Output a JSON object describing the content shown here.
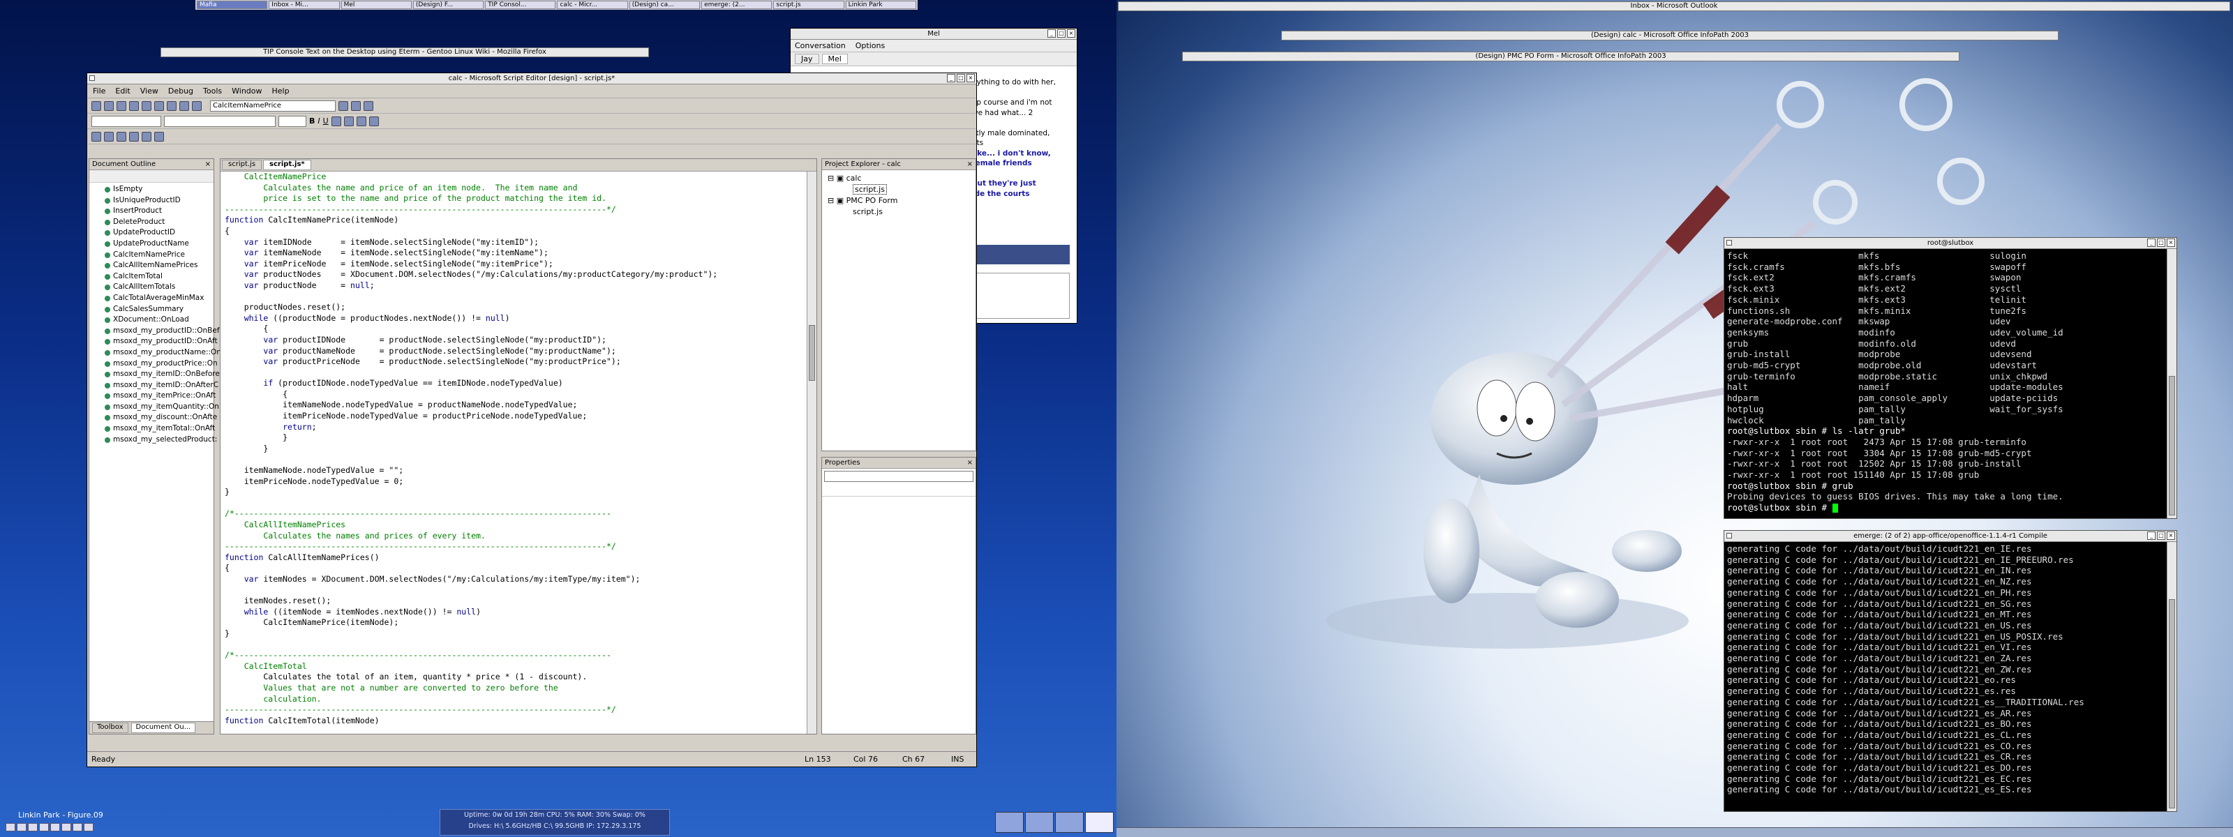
{
  "top_taskbar": {
    "items": [
      {
        "label": "Mafia",
        "active": true
      },
      {
        "label": "Inbox - Mi..."
      },
      {
        "label": "Mel"
      },
      {
        "label": "(Design) F..."
      },
      {
        "label": "TIP Consol..."
      },
      {
        "label": "calc - Micr..."
      },
      {
        "label": "(Design) ca..."
      },
      {
        "label": "emerge: (2..."
      },
      {
        "label": "script.js"
      },
      {
        "label": "Linkin Park"
      }
    ]
  },
  "firefox_title": "TIP Console Text on the Desktop using Eterm - Gentoo Linux Wiki - Mozilla Firefox",
  "outlook_title": "Inbox - Microsoft Outlook",
  "infopath_calc_title": "(Design) calc - Microsoft Office InfoPath 2003",
  "infopath_pmc_title": "(Design) PMC PO Form - Microsoft Office InfoPath 2003",
  "chat": {
    "title": "Mel",
    "menu": [
      "Conversation",
      "Options"
    ],
    "tabs": [
      "Jay",
      "Mel"
    ],
    "lines": [
      "nything to do with her,",
      "",
      "ap course and i'm not",
      "we had what... 2",
      "",
      "stly male dominated,",
      "pts",
      "like... i don't know,",
      "female friends",
      "",
      "but they're just",
      "ide the courts"
    ]
  },
  "editor": {
    "title": "calc - Microsoft Script Editor [design] - script.js*",
    "menu": [
      "File",
      "Edit",
      "View",
      "Debug",
      "Tools",
      "Window",
      "Help"
    ],
    "combo_value": "CalcItemNamePrice",
    "tabs": [
      "script.js",
      "script.js*"
    ],
    "status": {
      "ready": "Ready",
      "ln": "Ln 153",
      "col": "Col 76",
      "ch": "Ch 67",
      "ins": "INS"
    },
    "code_lines": [
      "    CalcItemNamePrice",
      "        Calculates the name and price of an item node.  The item name and",
      "        price is set to the name and price of the product matching the item id.",
      "-------------------------------------------------------------------------------*/",
      "function CalcItemNamePrice(itemNode)",
      "{",
      "    var itemIDNode      = itemNode.selectSingleNode(\"my:itemID\");",
      "    var itemNameNode    = itemNode.selectSingleNode(\"my:itemName\");",
      "    var itemPriceNode   = itemNode.selectSingleNode(\"my:itemPrice\");",
      "    var productNodes    = XDocument.DOM.selectNodes(\"/my:Calculations/my:productCategory/my:product\");",
      "    var productNode     = null;",
      "",
      "    productNodes.reset();",
      "    while ((productNode = productNodes.nextNode()) != null)",
      "        {",
      "        var productIDNode       = productNode.selectSingleNode(\"my:productID\");",
      "        var productNameNode     = productNode.selectSingleNode(\"my:productName\");",
      "        var productPriceNode    = productNode.selectSingleNode(\"my:productPrice\");",
      "",
      "        if (productIDNode.nodeTypedValue == itemIDNode.nodeTypedValue)",
      "            {",
      "            itemNameNode.nodeTypedValue = productNameNode.nodeTypedValue;",
      "            itemPriceNode.nodeTypedValue = productPriceNode.nodeTypedValue;",
      "            return;",
      "            }",
      "        }",
      "",
      "    itemNameNode.nodeTypedValue = \"\";",
      "    itemPriceNode.nodeTypedValue = 0;",
      "}",
      "",
      "/*------------------------------------------------------------------------------",
      "    CalcAllItemNamePrices",
      "        Calculates the names and prices of every item.",
      "-------------------------------------------------------------------------------*/",
      "function CalcAllItemNamePrices()",
      "{",
      "    var itemNodes = XDocument.DOM.selectNodes(\"/my:Calculations/my:itemType/my:item\");",
      "",
      "    itemNodes.reset();",
      "    while ((itemNode = itemNodes.nextNode()) != null)",
      "        CalcItemNamePrice(itemNode);",
      "}",
      "",
      "/*------------------------------------------------------------------------------",
      "    CalcItemTotal",
      "        Calculates the total of an item, quantity * price * (1 - discount).",
      "        Values that are not a number are converted to zero before the",
      "        calculation.",
      "-------------------------------------------------------------------------------*/",
      "function CalcItemTotal(itemNode)"
    ]
  },
  "outline": {
    "title": "Document Outline",
    "items": [
      "IsEmpty",
      "IsUniqueProductID",
      "InsertProduct",
      "DeleteProduct",
      "UpdateProductID",
      "UpdateProductName",
      "CalcItemNamePrice",
      "CalcAllItemNamePrices",
      "CalcItemTotal",
      "CalcAllItemTotals",
      "CalcTotalAverageMinMax",
      "CalcSalesSummary",
      "XDocument::OnLoad",
      "msoxd_my_productID::OnBef",
      "msoxd_my_productID::OnAft",
      "msoxd_my_productName::On",
      "msoxd_my_productPrice::On",
      "msoxd_my_itemID::OnBefore",
      "msoxd_my_itemID::OnAfterC",
      "msoxd_my_itemPrice::OnAft",
      "msoxd_my_itemQuantity::On",
      "msoxd_my_discount::OnAfte",
      "msoxd_my_itemTotal::OnAft",
      "msoxd_my_selectedProduct:"
    ],
    "bottom_tabs": [
      "Toolbox",
      "Document Ou..."
    ]
  },
  "project_explorer": {
    "title": "Project Explorer - calc",
    "tree": [
      "calc",
      "script.js",
      "PMC PO Form",
      "script.js"
    ]
  },
  "properties": {
    "title": "Properties"
  },
  "term1": {
    "title": "root@slutbox",
    "lines": [
      "fsck                     mkfs                     sulogin",
      "fsck.cramfs              mkfs.bfs                 swapoff",
      "fsck.ext2                mkfs.cramfs              swapon",
      "fsck.ext3                mkfs.ext2                sysctl",
      "fsck.minix               mkfs.ext3                telinit",
      "functions.sh             mkfs.minix               tune2fs",
      "generate-modprobe.conf   mkswap                   udev",
      "genksyms                 modinfo                  udev_volume_id",
      "grub                     modinfo.old              udevd",
      "grub-install             modprobe                 udevsend",
      "grub-md5-crypt           modprobe.old             udevstart",
      "grub-terminfo            modprobe.static          unix_chkpwd",
      "halt                     nameif                   update-modules",
      "hdparm                   pam_console_apply        update-pciids",
      "hotplug                  pam_tally                wait_for_sysfs",
      "hwclock                  pam_tally",
      "root@slutbox sbin # ls -latr grub*",
      "-rwxr-xr-x  1 root root   2473 Apr 15 17:08 grub-terminfo",
      "-rwxr-xr-x  1 root root   3304 Apr 15 17:08 grub-md5-crypt",
      "-rwxr-xr-x  1 root root  12502 Apr 15 17:08 grub-install",
      "-rwxr-xr-x  1 root root 151140 Apr 15 17:08 grub",
      "root@slutbox sbin # grub",
      "Probing devices to guess BIOS drives. This may take a long time.",
      "root@slutbox sbin # "
    ]
  },
  "term2": {
    "title": "emerge: (2 of 2) app-office/openoffice-1.1.4-r1 Compile",
    "lines": [
      "generating C code for ../data/out/build/icudt221_en_IE.res",
      "generating C code for ../data/out/build/icudt221_en_IE_PREEURO.res",
      "generating C code for ../data/out/build/icudt221_en_IN.res",
      "generating C code for ../data/out/build/icudt221_en_NZ.res",
      "generating C code for ../data/out/build/icudt221_en_PH.res",
      "generating C code for ../data/out/build/icudt221_en_SG.res",
      "generating C code for ../data/out/build/icudt221_en_MT.res",
      "generating C code for ../data/out/build/icudt221_en_US.res",
      "generating C code for ../data/out/build/icudt221_en_US_POSIX.res",
      "generating C code for ../data/out/build/icudt221_en_VI.res",
      "generating C code for ../data/out/build/icudt221_en_ZA.res",
      "generating C code for ../data/out/build/icudt221_en_ZW.res",
      "generating C code for ../data/out/build/icudt221_eo.res",
      "generating C code for ../data/out/build/icudt221_es.res",
      "generating C code for ../data/out/build/icudt221_es__TRADITIONAL.res",
      "generating C code for ../data/out/build/icudt221_es_AR.res",
      "generating C code for ../data/out/build/icudt221_es_BO.res",
      "generating C code for ../data/out/build/icudt221_es_CL.res",
      "generating C code for ../data/out/build/icudt221_es_CO.res",
      "generating C code for ../data/out/build/icudt221_es_CR.res",
      "generating C code for ../data/out/build/icudt221_es_DO.res",
      "generating C code for ../data/out/build/icudt221_es_EC.res",
      "generating C code for ../data/out/build/icudt221_es_ES.res"
    ]
  },
  "bottom": {
    "now_playing": "Linkin Park - Figure.09",
    "sysinfo_line1": "Uptime: 0w 0d 19h 28m   CPU: 5%   RAM: 30%   Swap: 0%",
    "sysinfo_line2": "Drives: H:\\ 5.6GHz/HB C:\\ 99.5GHB   IP: 172.29.3.175"
  },
  "colors": {
    "accent": "#6a7cc0",
    "terminal_bg": "#000000",
    "comment": "#008000"
  }
}
